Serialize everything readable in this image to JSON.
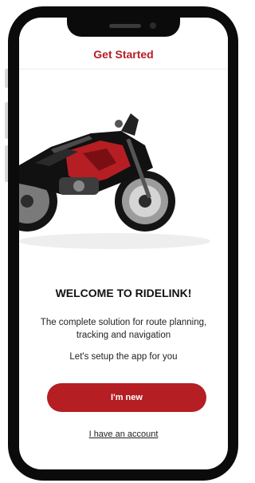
{
  "header": {
    "title": "Get Started"
  },
  "welcome": {
    "heading": "WELCOME TO RIDELINK!",
    "description": "The complete solution for route planning, tracking and navigation",
    "setup_text": "Let's setup the app for you"
  },
  "actions": {
    "new_button": "I'm new",
    "account_link": "I have an account"
  },
  "colors": {
    "accent": "#b51e23"
  },
  "hero": {
    "image": "motorcycle-illustration"
  }
}
